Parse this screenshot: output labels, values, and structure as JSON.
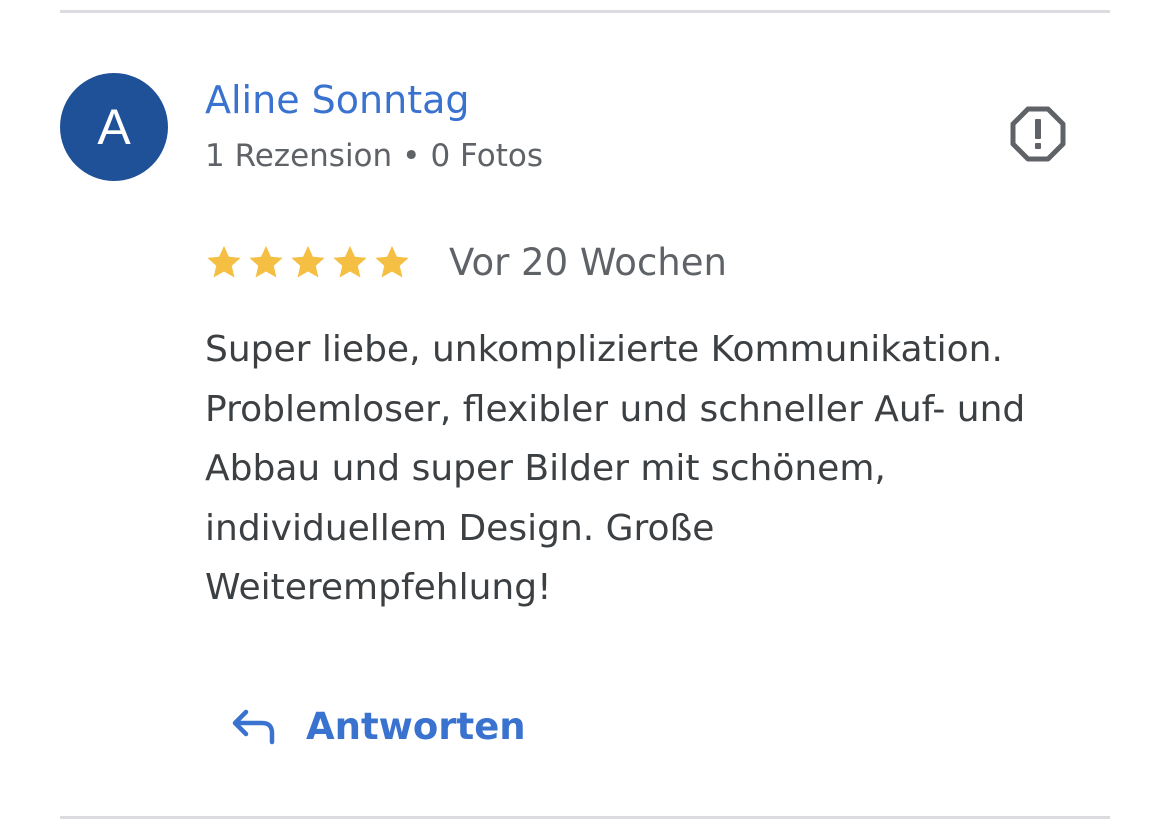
{
  "review": {
    "avatar_letter": "A",
    "author": "Aline Sonntag",
    "review_count": "1 Rezension",
    "separator": "•",
    "photo_count": "0 Fotos",
    "rating": 5,
    "rating_max": 5,
    "time_ago": "Vor 20 Wochen",
    "text_lines": [
      "Super liebe, unkomplizierte Kommunikation.",
      "Problemloser, flexibler und schneller Auf- und",
      "Abbau und super Bilder mit schönem,",
      "individuellem Design. Große",
      "Weiterempfehlung!"
    ],
    "reply_label": "Antworten"
  },
  "icons": {
    "report": "report-octagon-icon",
    "reply": "reply-arrow-icon",
    "star": "star-icon"
  },
  "colors": {
    "avatar_bg": "#1f5199",
    "link": "#3a72d0",
    "star": "#f4bf42",
    "text": "#3c4043",
    "muted": "#5f6368"
  }
}
